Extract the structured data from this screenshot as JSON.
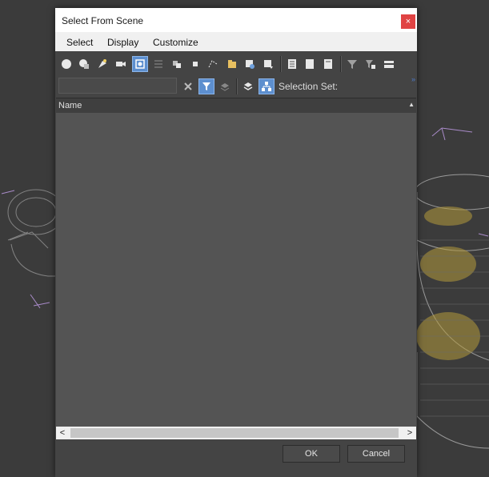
{
  "dialog": {
    "title": "Select From Scene",
    "close_icon": "×",
    "menu": [
      "Select",
      "Display",
      "Customize"
    ]
  },
  "toolbar": {
    "filter_placeholder": "",
    "selection_set_label": "Selection Set:",
    "expand_glyph": "»"
  },
  "list": {
    "column_name": "Name",
    "sort_glyph": "▲",
    "rows": []
  },
  "scroll": {
    "left": "<",
    "right": ">"
  },
  "buttons": {
    "ok": "OK",
    "cancel": "Cancel"
  },
  "colors": {
    "active_button": "#5d8fcf",
    "close_button": "#e04343",
    "list_background": "#545454"
  }
}
